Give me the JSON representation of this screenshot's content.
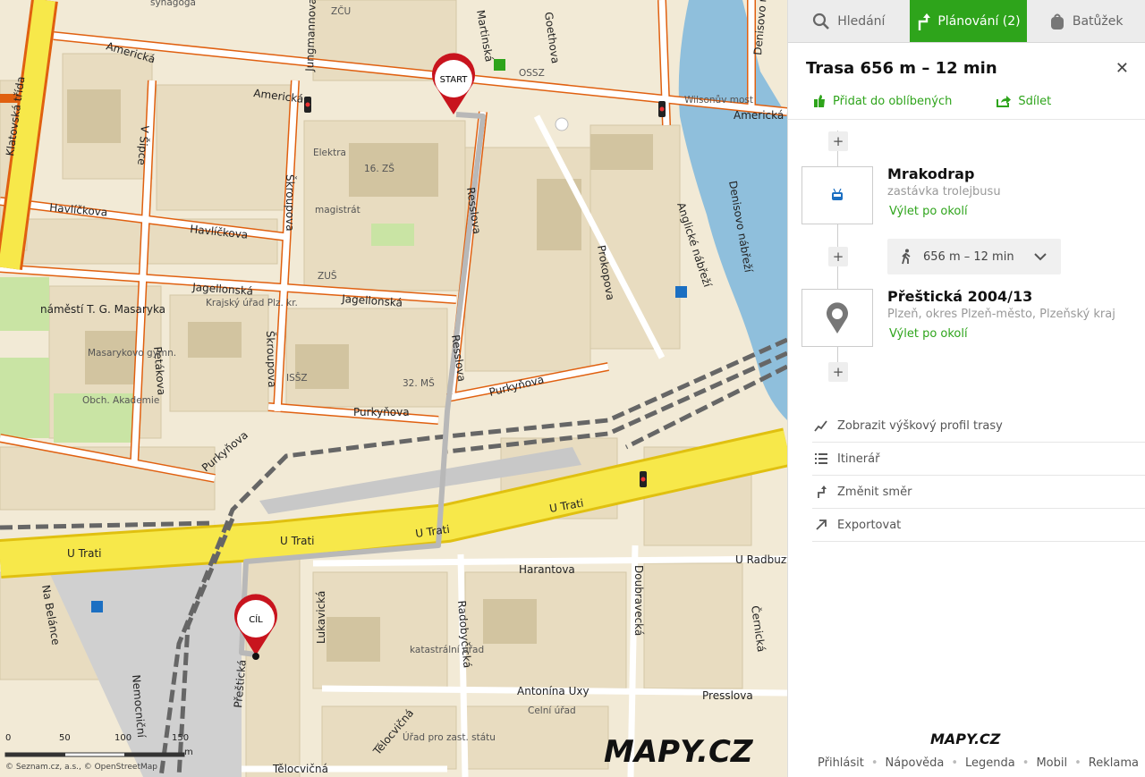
{
  "tabs": {
    "search": "Hledání",
    "planning": "Plánování (2)",
    "backpack": "Batůžek"
  },
  "route": {
    "title": "Trasa 656 m – 12 min",
    "add_favorite": "Přidat do oblíbených",
    "share": "Sdílet"
  },
  "stops": [
    {
      "name": "Mrakodrap",
      "sub": "zastávka trolejbusu",
      "link": "Výlet po okolí"
    },
    {
      "name": "Přeštická 2004/13",
      "sub": "Plzeň, okres Plzeň-město, Plzeňský kraj",
      "link": "Výlet po okolí"
    }
  ],
  "segment": {
    "text": "656 m – 12 min"
  },
  "menu": [
    "Zobrazit výškový profil trasy",
    "Itinerář",
    "Změnit směr",
    "Exportovat"
  ],
  "footer": {
    "logo": "MAPY.CZ",
    "links": [
      "Přihlásit",
      "Nápověda",
      "Legenda",
      "Mobil",
      "Reklama"
    ]
  },
  "map": {
    "logo": "MAPY.CZ",
    "start_label": "START",
    "end_label": "CÍL",
    "attribution": "© Seznam.cz, a.s., © OpenStreetMap",
    "scale_labels": [
      "0",
      "50",
      "100",
      "150",
      "m"
    ],
    "streets": [
      "Americká",
      "Americká",
      "Americká",
      "Havlíčkova",
      "Havlíčkova",
      "Jagellonská",
      "Jagellonská",
      "Purkyňova",
      "Purkyňova",
      "Purkyňova",
      "U Trati",
      "U Trati",
      "U Trati",
      "U Trati",
      "Harantova",
      "U Radbuzy",
      "Antonína Uxy",
      "Presslova",
      "Tělocvičná",
      "Tělocvičná",
      "Klatovská třída",
      "Jungmannova",
      "Martinská",
      "Goethova",
      "Resslova",
      "Resslova",
      "Prokopova",
      "Anglické nábřeží",
      "Denisovo nábřeží",
      "Denisovo nábřeží",
      "Škroupova",
      "Škroupova",
      "Petákova",
      "V Šipce",
      "Přeštická",
      "Lukavická",
      "Radobyčická",
      "Na Belánce",
      "Nemocniční",
      "Doubravecká",
      "Černická",
      "Wilsonův most",
      "náměstí T. G. Masaryka"
    ],
    "pois": [
      "ZČU",
      "OSSZ",
      "Elektra",
      "16. ZŠ",
      "magistrát",
      "ZUŠ",
      "Krajský úřad Plz. kr.",
      "Masarykovo gymn.",
      "Obch. Akademie",
      "ISŠZ",
      "32. MŠ",
      "katastrální úřad",
      "Celní úřad",
      "Úřad pro zast. státu",
      "synagoga"
    ]
  },
  "colors": {
    "accent": "#2ea41b",
    "road_main": "#f7e84a",
    "road_border": "#e06010",
    "water": "#8fbfdc",
    "block": "#e8dcc0",
    "rail": "#666666",
    "route": "#b8b8b8",
    "pin": "#c8141e"
  }
}
